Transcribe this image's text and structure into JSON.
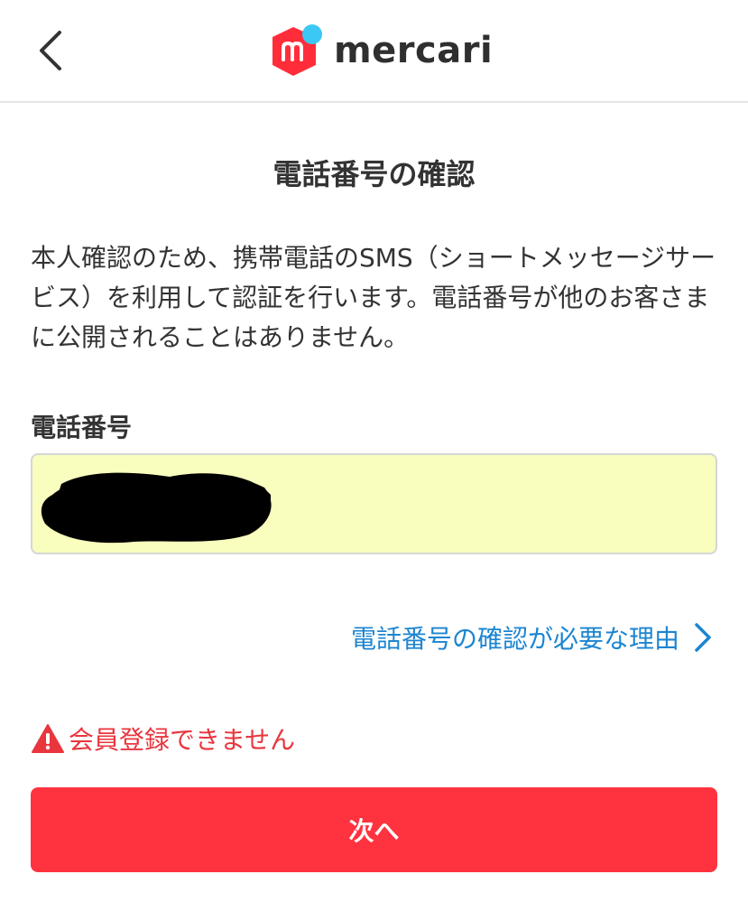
{
  "header": {
    "back_icon": "chevron-left-icon",
    "logo_icon": "mercari-box-icon",
    "logo_text": "mercari"
  },
  "page": {
    "title": "電話番号の確認",
    "description": "本人確認のため、携帯電話のSMS（ショートメッセージサービス）を利用して認証を行います。電話番号が他のお客さまに公開されることはありません。"
  },
  "phone_field": {
    "label": "電話番号",
    "value": ""
  },
  "reason_link": {
    "label": "電話番号の確認が必要な理由",
    "icon": "chevron-right-icon"
  },
  "error": {
    "icon": "warning-icon",
    "message": "会員登録できません"
  },
  "next_button": {
    "label": "次へ"
  },
  "colors": {
    "primary_red": "#ff333f",
    "error_red": "#e9353e",
    "link_blue": "#1c85d1",
    "input_bg": "#f9fdbd",
    "logo_dot": "#3cc8f4"
  }
}
